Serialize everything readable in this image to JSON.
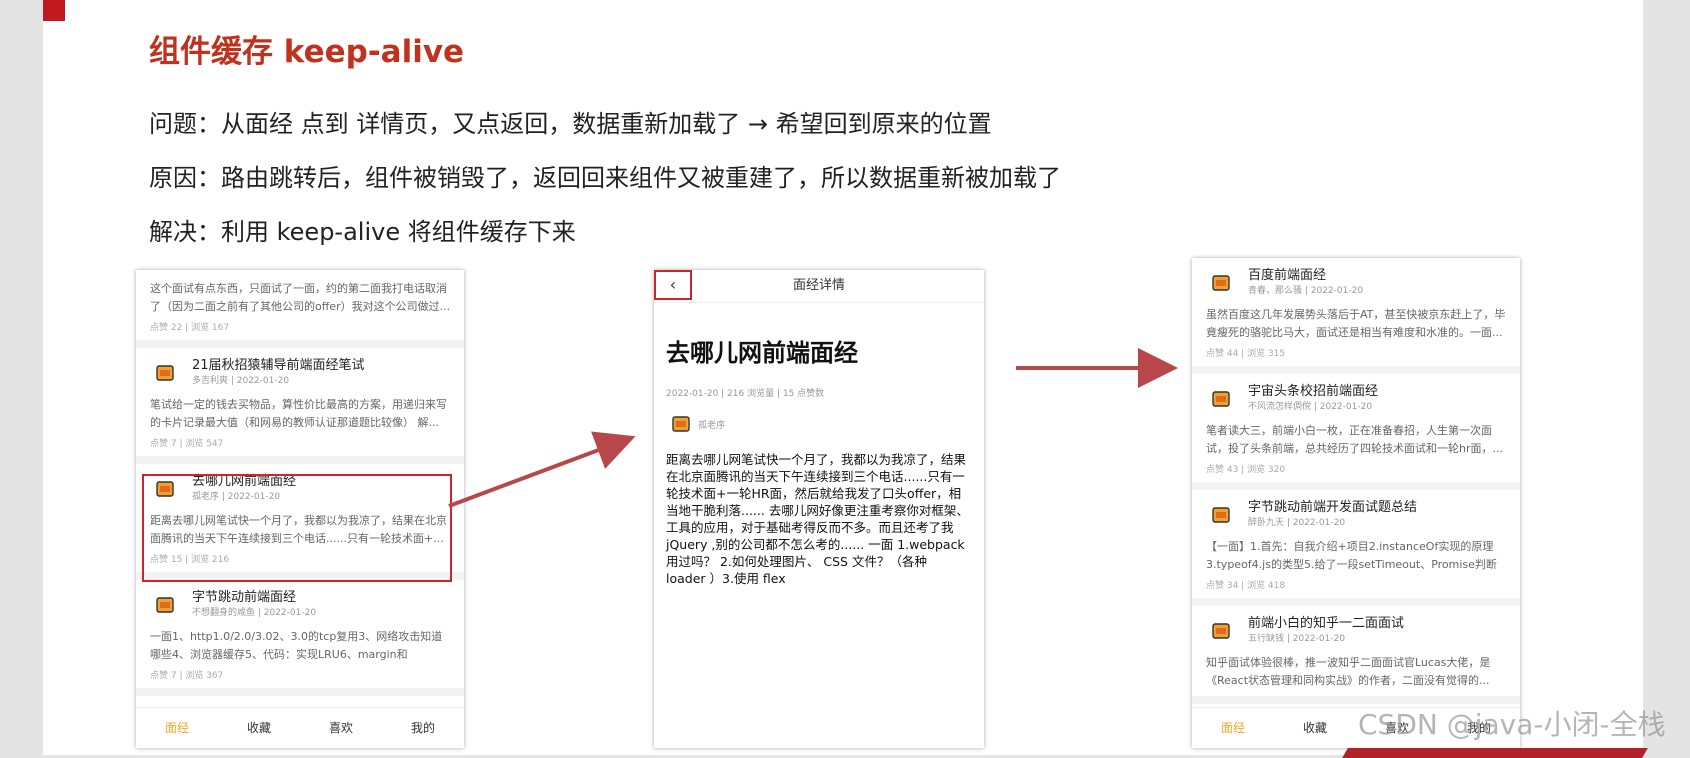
{
  "slide": {
    "title": "组件缓存 keep-alive",
    "problem": "问题：从面经 点到 详情页，又点返回，数据重新加载了 → 希望回到原来的位置",
    "cause": "原因：路由跳转后，组件被销毁了，返回回来组件又被重建了，所以数据重新被加载了",
    "solution": "解决：利用 keep-alive 将组件缓存下来",
    "watermark": "CSDN @java-小闭-全栈"
  },
  "colors": {
    "accent": "#c0321d",
    "highlight": "#d0242b",
    "tab_active": "#f5a623",
    "arrow": "#b8474a"
  },
  "list_screen": {
    "partial_card": {
      "body": "这个面试有点东西，只面试了一面，约的第二面我打电话取消了（因为二面之前有了其他公司的offer）我对这个公司做过...",
      "stats": "点赞 22 | 浏览 167"
    },
    "cards": [
      {
        "title": "21届秋招猿辅导前端面经笔试",
        "sub": "多吉利爽 | 2022-01-20",
        "body": "笔试给一定的钱去买物品，算性价比最高的方案，用递归来写的卡片记录最大值（和网易的教师认证那道题比较像） 解...",
        "stats": "点赞 7 | 浏览 547"
      },
      {
        "title": "去哪儿网前端面经",
        "sub": "孤老序 | 2022-01-20",
        "body": "距离去哪儿网笔试快一个月了，我都以为我凉了，结果在北京面腾讯的当天下午连续接到三个电话......只有一轮技术面+...",
        "stats": "点赞 15 | 浏览 216"
      },
      {
        "title": "字节跳动前端面经",
        "sub": "不想翻身的咸鱼 | 2022-01-20",
        "body": "一面1、http1.0/2.0/3.02、3.0的tcp复用3、网络攻击知道哪些4、浏览器缓存5、代码：实现LRU6、margin和paddin...",
        "stats": "点赞 7 | 浏览 367"
      }
    ],
    "tabs": [
      "面经",
      "收藏",
      "喜欢",
      "我的"
    ]
  },
  "detail_screen": {
    "back_icon": "chevron-left-icon",
    "nav_title": "面经详情",
    "title": "去哪儿网前端面经",
    "meta": "2022-01-20 | 216 浏览量 | 15 点赞数",
    "author": "孤老序",
    "body": "距离去哪儿网笔试快一个月了，我都以为我凉了，结果在北京面腾讯的当天下午连续接到三个电话......只有一轮技术面+一轮HR面，然后就给我发了口头offer，相当地干脆利落...... 去哪儿网好像更注重考察你对框架、工具的应用，对于基础考得反而不多。而且还考了我 jQuery ,别的公司都不怎么考的...... 一面 1.webpack 用过吗？ 2.如何处理图片、 CSS 文件？（各种 loader ）3.使用 flex"
  },
  "list_screen_2": {
    "cards": [
      {
        "title": "百度前端面经",
        "sub": "青春，那么骚 | 2022-01-20",
        "body": "虽然百度这几年发展势头落后于AT，甚至快被京东赶上了，毕竟瘦死的骆驼比马大，面试还是相当有难度和水准的。一面...",
        "stats": "点赞 44 | 浏览 315"
      },
      {
        "title": "宇宙头条校招前端面经",
        "sub": "不风流怎样倜傥 | 2022-01-20",
        "body": "笔者读大三，前端小白一枚，正在准备春招，人生第一次面试，投了头条前端，总共经历了四轮技术面试和一轮hr面，...",
        "stats": "点赞 43 | 浏览 320"
      },
      {
        "title": "字节跳动前端开发面试题总结",
        "sub": "醉卧九天 | 2022-01-20",
        "body": "【一面】1.首先：自我介绍+项目2.instanceOf实现的原理3.typeof4.js的类型5.给了一段setTimeout、Promise判断输...",
        "stats": "点赞 34 | 浏览 418"
      },
      {
        "title": "前端小白的知乎一二面面试",
        "sub": "五行缺钱 | 2022-01-20",
        "body": "知乎面试体验很棒，推一波知乎二面面试官Lucas大佬，是《React状态管理和同构实战》的作者，二面没有觉得的...",
        "stats": ""
      }
    ],
    "tabs": [
      "面经",
      "收藏",
      "喜欢",
      "我的"
    ]
  }
}
